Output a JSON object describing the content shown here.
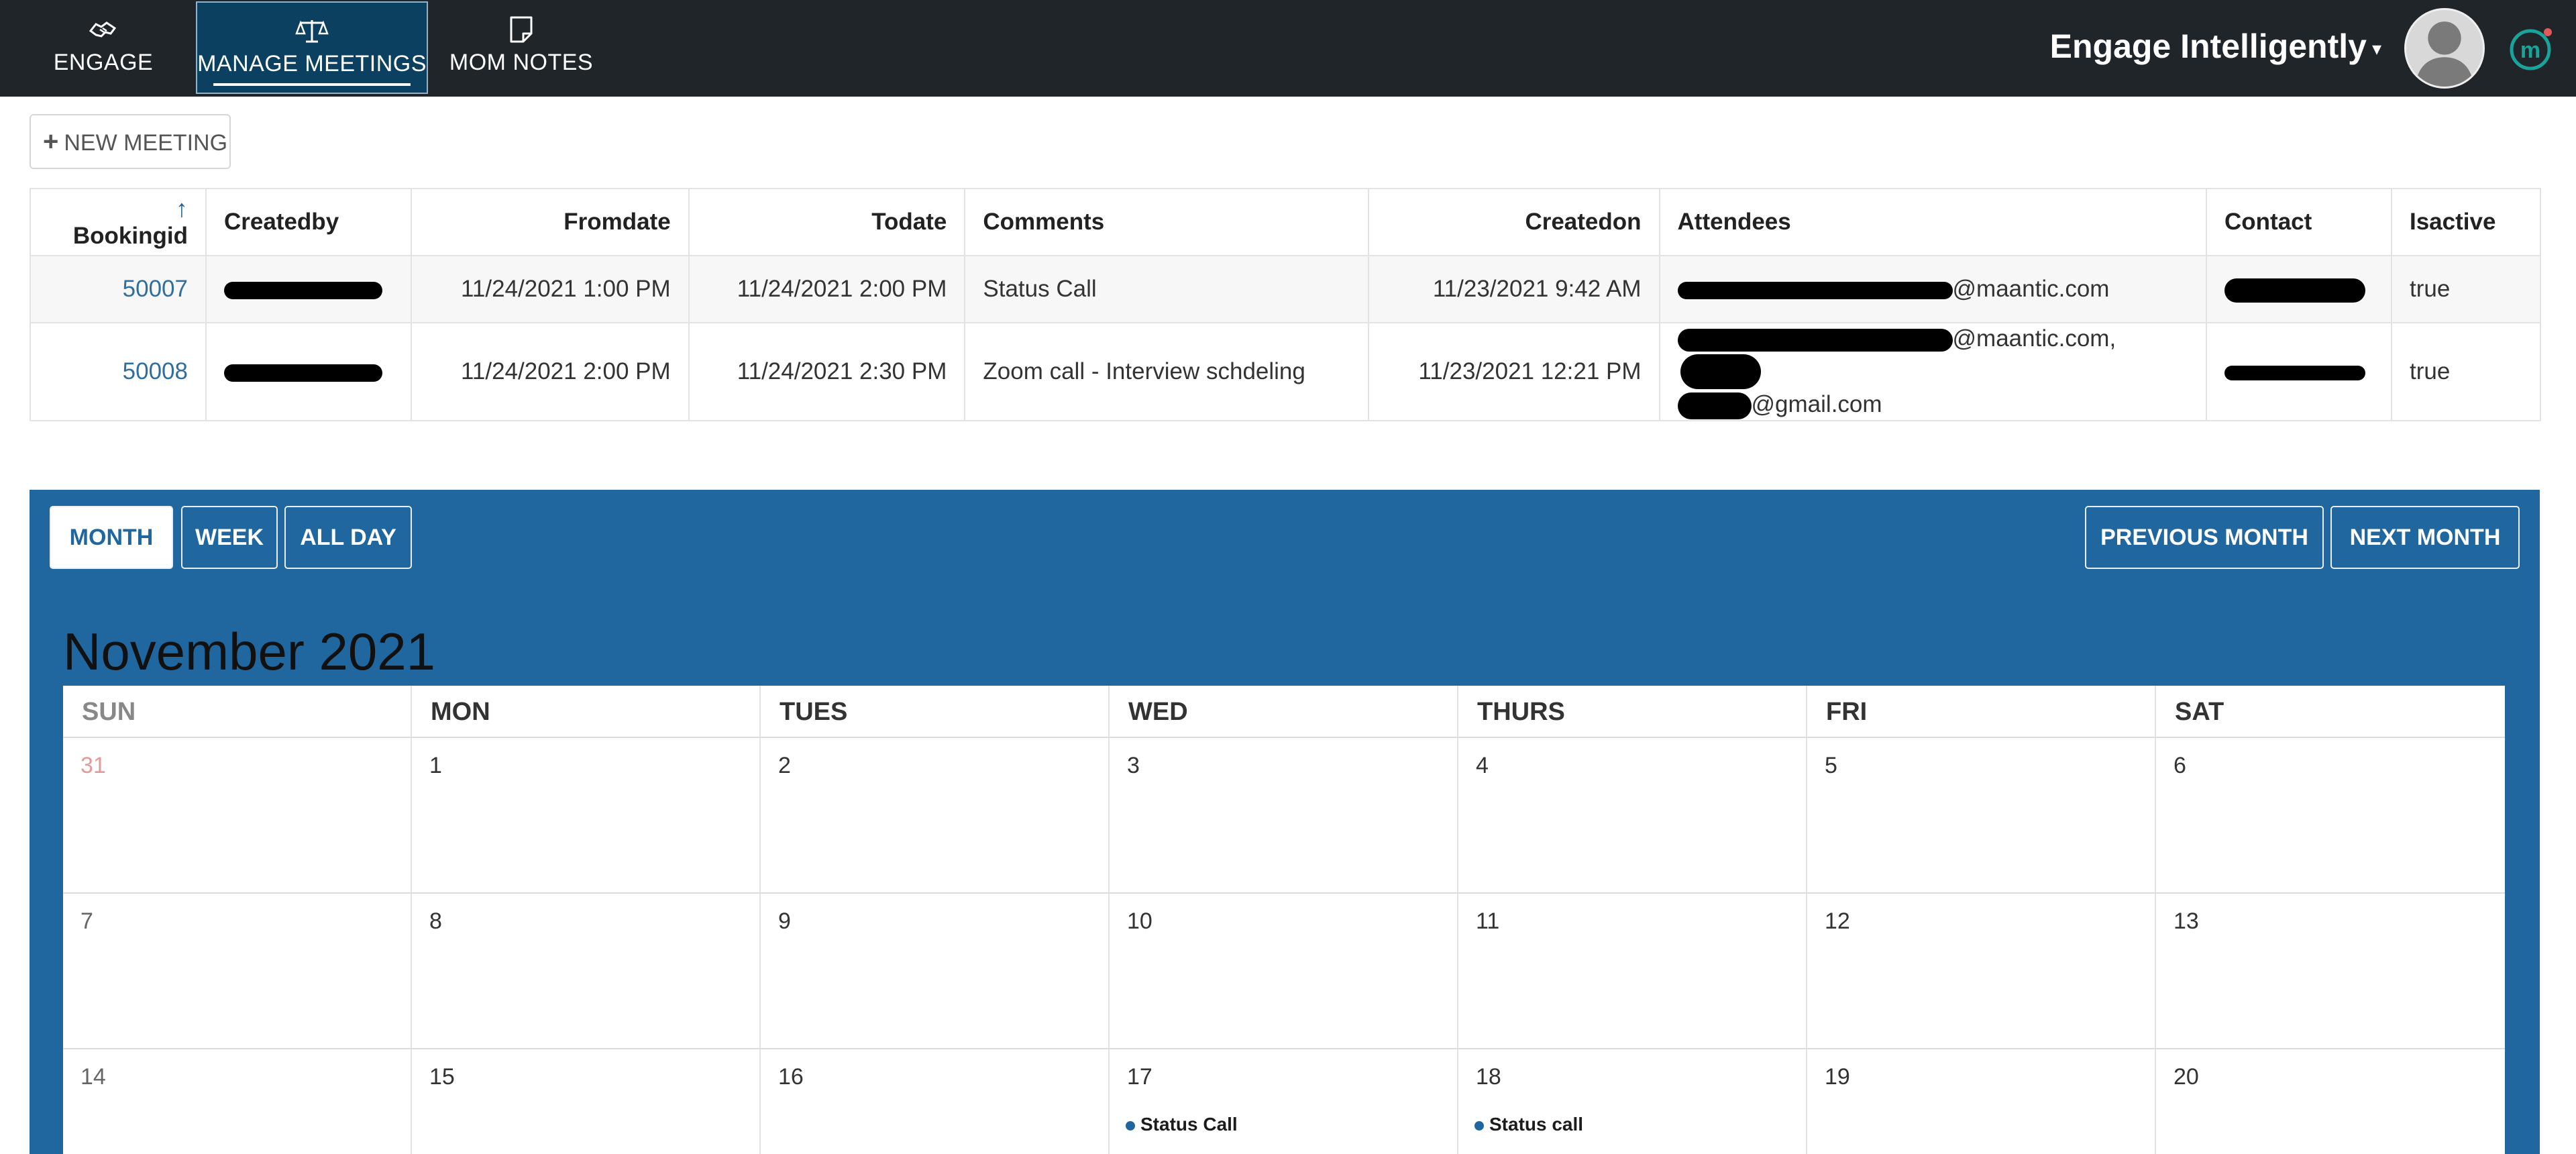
{
  "nav": {
    "tabs": [
      {
        "label": "ENGAGE",
        "icon": "handshake-icon"
      },
      {
        "label": "MANAGE MEETINGS",
        "icon": "scales-icon",
        "active": true
      },
      {
        "label": "MOM NOTES",
        "icon": "note-icon"
      }
    ],
    "brand": "Engage Intelligently",
    "brand_caret": "▾",
    "avatar_icon": "user-avatar-icon",
    "logo_icon": "m-logo-icon"
  },
  "toolbar": {
    "plus": "+",
    "new_meeting": "NEW MEETING"
  },
  "table": {
    "sort_icon": "↑",
    "columns": [
      "Bookingid",
      "Createdby",
      "Fromdate",
      "Todate",
      "Comments",
      "Createdon",
      "Attendees",
      "Contact",
      "Isactive"
    ],
    "rows": [
      {
        "bookingid": "50007",
        "fromdate": "11/24/2021 1:00 PM",
        "todate": "11/24/2021 2:00 PM",
        "comments": "Status Call",
        "createdon": "11/23/2021 9:42 AM",
        "attendees": "@maantic.com",
        "isactive": "true"
      },
      {
        "bookingid": "50008",
        "fromdate": "11/24/2021 2:00 PM",
        "todate": "11/24/2021 2:30 PM",
        "comments": "Zoom call - Interview schdeling",
        "createdon": "11/23/2021 12:21 PM",
        "attendees_line1": "@maantic.com,",
        "attendees_line2": "@gmail.com",
        "isactive": "true"
      }
    ]
  },
  "calendar": {
    "buttons": {
      "month": "MONTH",
      "week": "WEEK",
      "allday": "ALL DAY",
      "prev": "PREVIOUS MONTH",
      "next": "NEXT MONTH"
    },
    "title": "November 2021",
    "weekdays": [
      "SUN",
      "MON",
      "TUES",
      "WED",
      "THURS",
      "FRI",
      "SAT"
    ],
    "weeks": [
      [
        "31",
        "1",
        "2",
        "3",
        "4",
        "5",
        "6"
      ],
      [
        "7",
        "8",
        "9",
        "10",
        "11",
        "12",
        "13"
      ],
      [
        "14",
        "15",
        "16",
        "17",
        "18",
        "19",
        "20"
      ]
    ],
    "events": {
      "wed17": "Status Call",
      "thu18": "Status call"
    },
    "accent": "#21679f"
  }
}
